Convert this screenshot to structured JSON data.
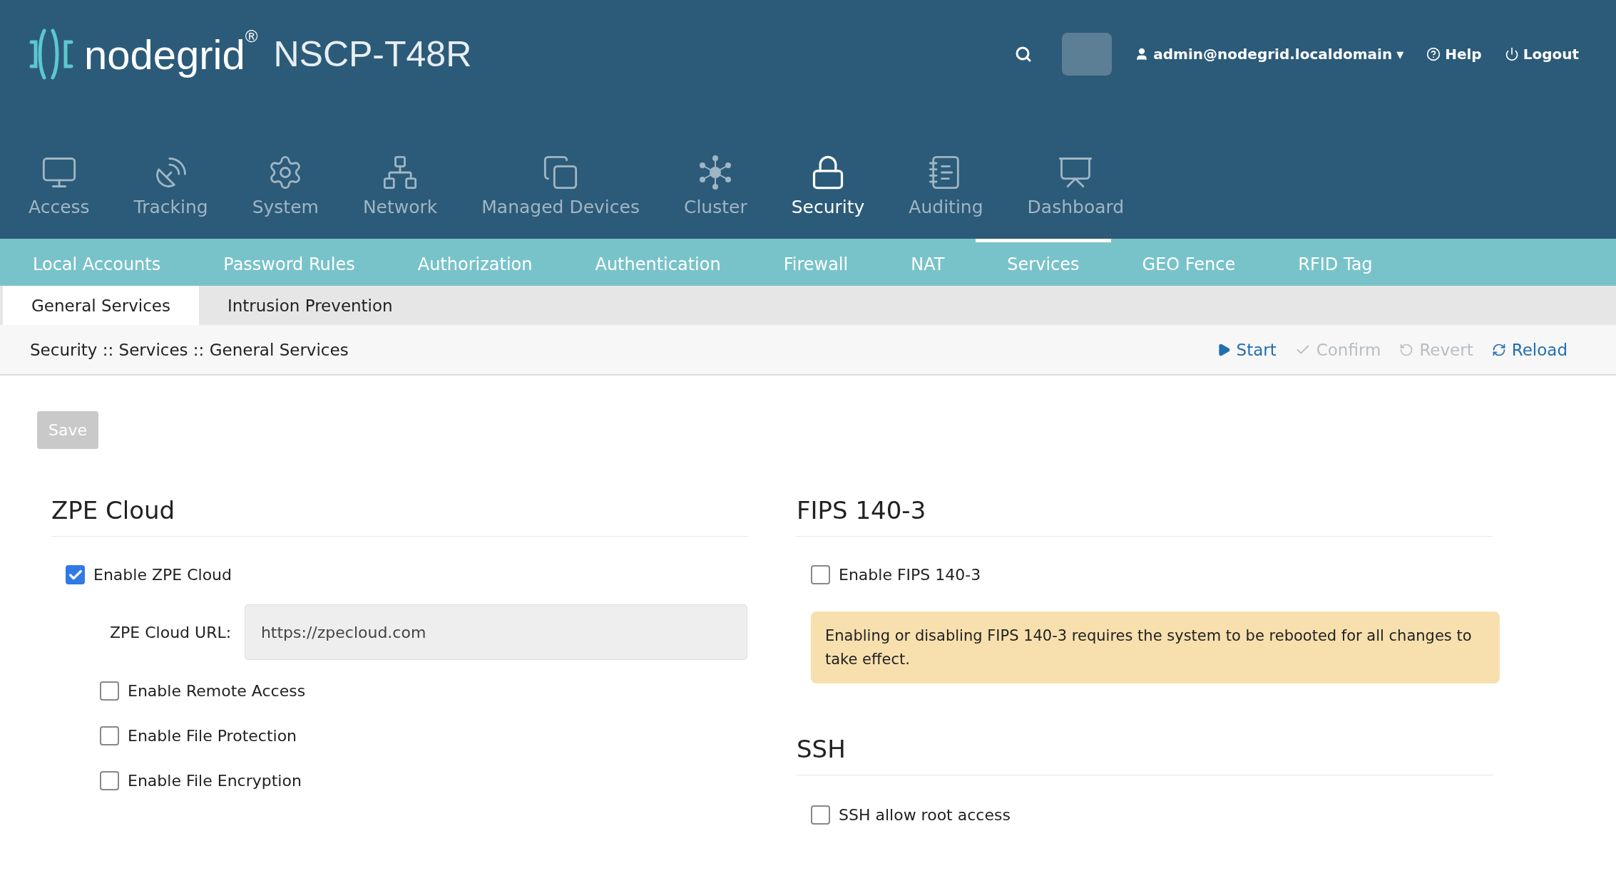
{
  "header": {
    "brand": "nodegrid$^{®}$",
    "model": "NSCP-T48R",
    "user": "admin@nodegrid.localdomain",
    "user_caret": "▾",
    "help": "Help",
    "logout": "Logout"
  },
  "main_nav": [
    {
      "label": "Access",
      "selected": false
    },
    {
      "label": "Tracking",
      "selected": false
    },
    {
      "label": "System",
      "selected": false
    },
    {
      "label": "Network",
      "selected": false
    },
    {
      "label": "Managed Devices",
      "selected": false
    },
    {
      "label": "Cluster",
      "selected": false
    },
    {
      "label": "Security",
      "selected": true
    },
    {
      "label": "Auditing",
      "selected": false
    },
    {
      "label": "Dashboard",
      "selected": false
    }
  ],
  "sub_nav": [
    {
      "label": "Local Accounts",
      "selected": false
    },
    {
      "label": "Password Rules",
      "selected": false
    },
    {
      "label": "Authorization",
      "selected": false
    },
    {
      "label": "Authentication",
      "selected": false
    },
    {
      "label": "Firewall",
      "selected": false
    },
    {
      "label": "NAT",
      "selected": false
    },
    {
      "label": "Services",
      "selected": true
    },
    {
      "label": "GEO Fence",
      "selected": false
    },
    {
      "label": "RFID Tag",
      "selected": false
    }
  ],
  "tabs": [
    {
      "label": "General Services",
      "selected": true
    },
    {
      "label": "Intrusion Prevention",
      "selected": false
    }
  ],
  "breadcrumb": "Security :: Services :: General Services",
  "actions": [
    {
      "label": "Start",
      "kind": "start",
      "disabled": false
    },
    {
      "label": "Confirm",
      "kind": "confirm",
      "disabled": true
    },
    {
      "label": "Revert",
      "kind": "revert",
      "disabled": true
    },
    {
      "label": "Reload",
      "kind": "reload",
      "disabled": false
    }
  ],
  "save_button": {
    "label": "Save",
    "disabled": true
  },
  "zpe_cloud": {
    "title": "ZPE Cloud",
    "enable": {
      "label": "Enable ZPE Cloud",
      "checked": true
    },
    "url_field": {
      "label": "ZPE Cloud URL:",
      "value": "https://zpecloud.com"
    },
    "options": [
      {
        "label": "Enable Remote Access",
        "checked": false
      },
      {
        "label": "Enable File Protection",
        "checked": false
      },
      {
        "label": "Enable File Encryption",
        "checked": false
      }
    ]
  },
  "fips": {
    "title": "FIPS 140-3",
    "enable": {
      "label": "Enable FIPS 140-3",
      "checked": false
    },
    "warning": "Enabling or disabling FIPS 140-3 requires the system to be rebooted for all changes to take effect."
  },
  "ssh": {
    "title": "SSH",
    "options": [
      {
        "label": "SSH allow root access",
        "checked": false
      }
    ]
  }
}
